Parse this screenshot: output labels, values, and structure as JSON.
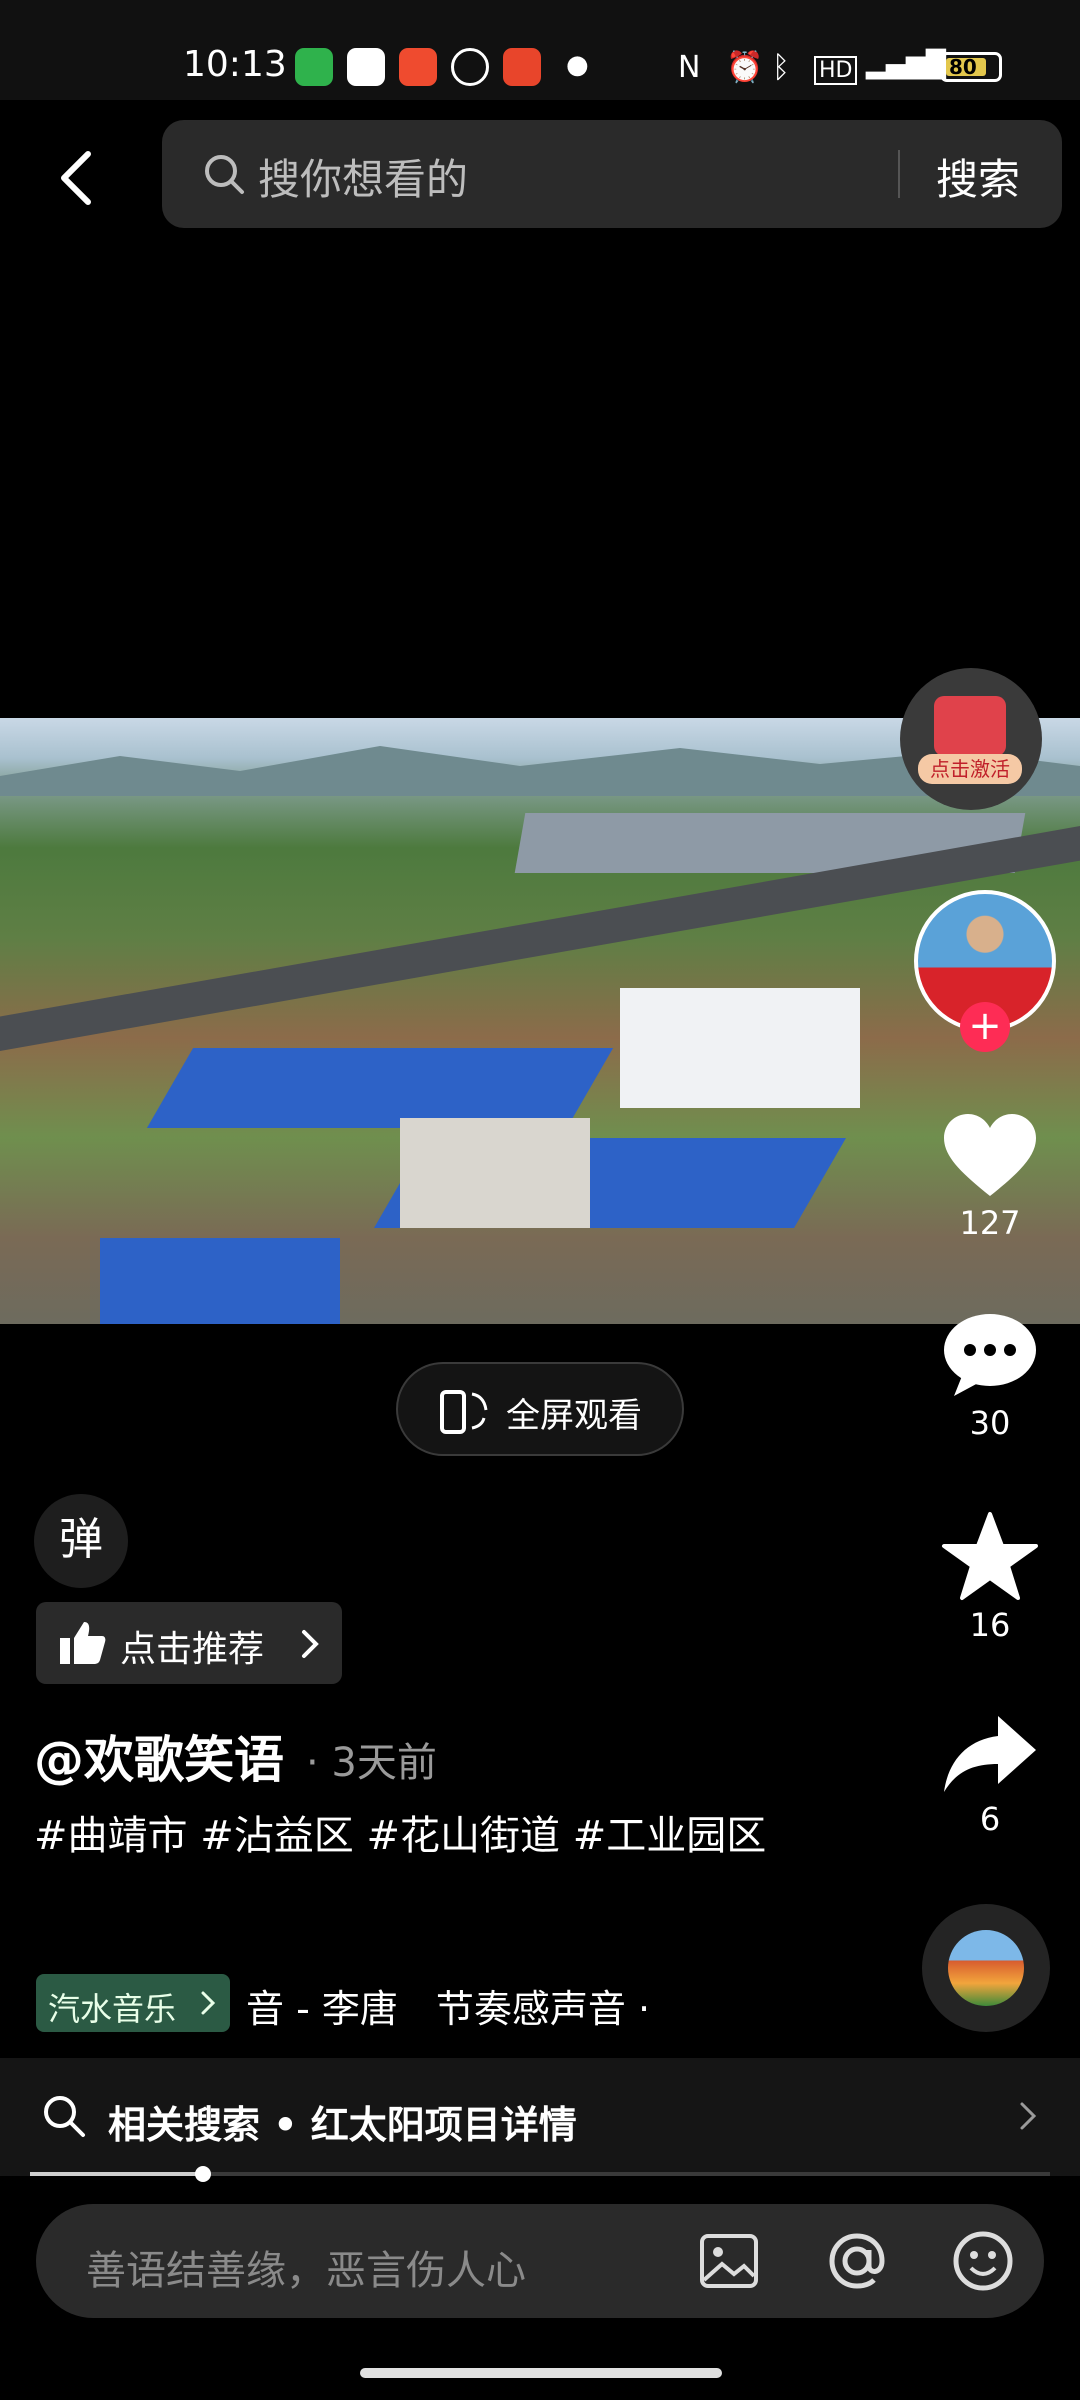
{
  "status_bar": {
    "time": "10:13",
    "battery": "80"
  },
  "search": {
    "placeholder": "搜你想看的",
    "button": "搜索"
  },
  "rail": {
    "activate_label": "点击激活",
    "likes": "127",
    "comments": "30",
    "favorites": "16",
    "shares": "6"
  },
  "video": {
    "fullscreen_label": "全屏观看"
  },
  "danmaku": {
    "label": "弹"
  },
  "recommend": {
    "label": "点击推荐"
  },
  "post": {
    "author": "@欢歌笑语",
    "time_ago": "· 3天前",
    "description": "#曲靖市 #沾益区 #花山街道 #工业园区",
    "music_tag": "汽水音乐",
    "music_text": "音 - 李唐　节奏感声音 ·"
  },
  "related_search": {
    "label": "相关搜索 • 红太阳项目详情"
  },
  "progress": {
    "fraction": 0.17
  },
  "comment": {
    "placeholder": "善语结善缘，恶言伤人心"
  },
  "colors": {
    "accent": "#fe2c55",
    "background": "#000000",
    "music_tag_bg": "#2b5a44"
  }
}
